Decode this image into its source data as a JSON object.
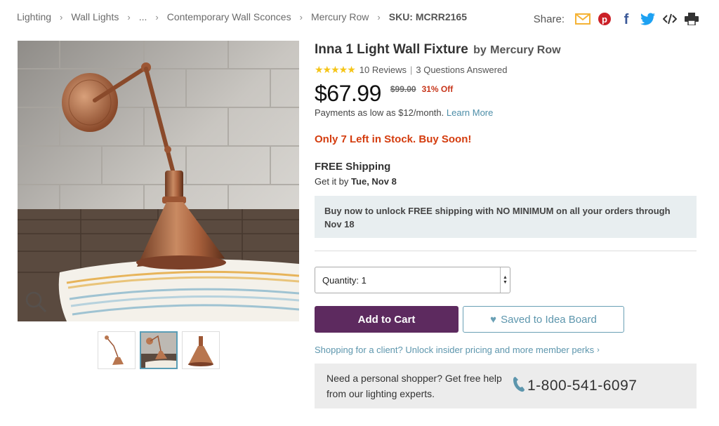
{
  "breadcrumb": {
    "items": [
      "Lighting",
      "Wall Lights",
      "...",
      "Contemporary Wall Sconces",
      "Mercury Row"
    ],
    "sku": "SKU: MCRR2165"
  },
  "share": {
    "label": "Share:",
    "icons": [
      "email-icon",
      "pinterest-icon",
      "facebook-icon",
      "twitter-icon",
      "embed-icon",
      "print-icon"
    ],
    "colors": {
      "email": "#f5b335",
      "pinterest": "#cb2027",
      "facebook": "#3b5998",
      "twitter": "#1da1f2"
    }
  },
  "product": {
    "title": "Inna 1 Light Wall Fixture",
    "by": "by",
    "brand": "Mercury Row",
    "stars": "★★★★★",
    "reviews": "10 Reviews",
    "questions": "3 Questions Answered",
    "price": "$67.99",
    "old_price": "$99.00",
    "discount": "31% Off",
    "payments_text": "Payments as low as $12/month.",
    "learn_more": "Learn More",
    "stock": "Only 7 Left in Stock. Buy Soon!",
    "shipping_title": "FREE Shipping",
    "ship_prefix": "Get it by",
    "ship_date": "Tue, Nov 8",
    "promo": "Buy now to unlock FREE shipping with NO MINIMUM on all your orders through Nov 18"
  },
  "purchase": {
    "quantity_label": "Quantity: 1",
    "add_to_cart": "Add to Cart",
    "saved_label": "Saved to Idea Board",
    "client_link": "Shopping for a client? Unlock insider pricing and more member perks",
    "shopper_text": "Need a personal shopper? Get free help from our lighting experts.",
    "phone": "1-800-541-6097"
  },
  "colors": {
    "accent_purple": "#5d2a5f",
    "link_teal": "#5d96ad",
    "stock_red": "#d43c0e",
    "discount_red": "#c7361b",
    "star_yellow": "#f5c518"
  }
}
